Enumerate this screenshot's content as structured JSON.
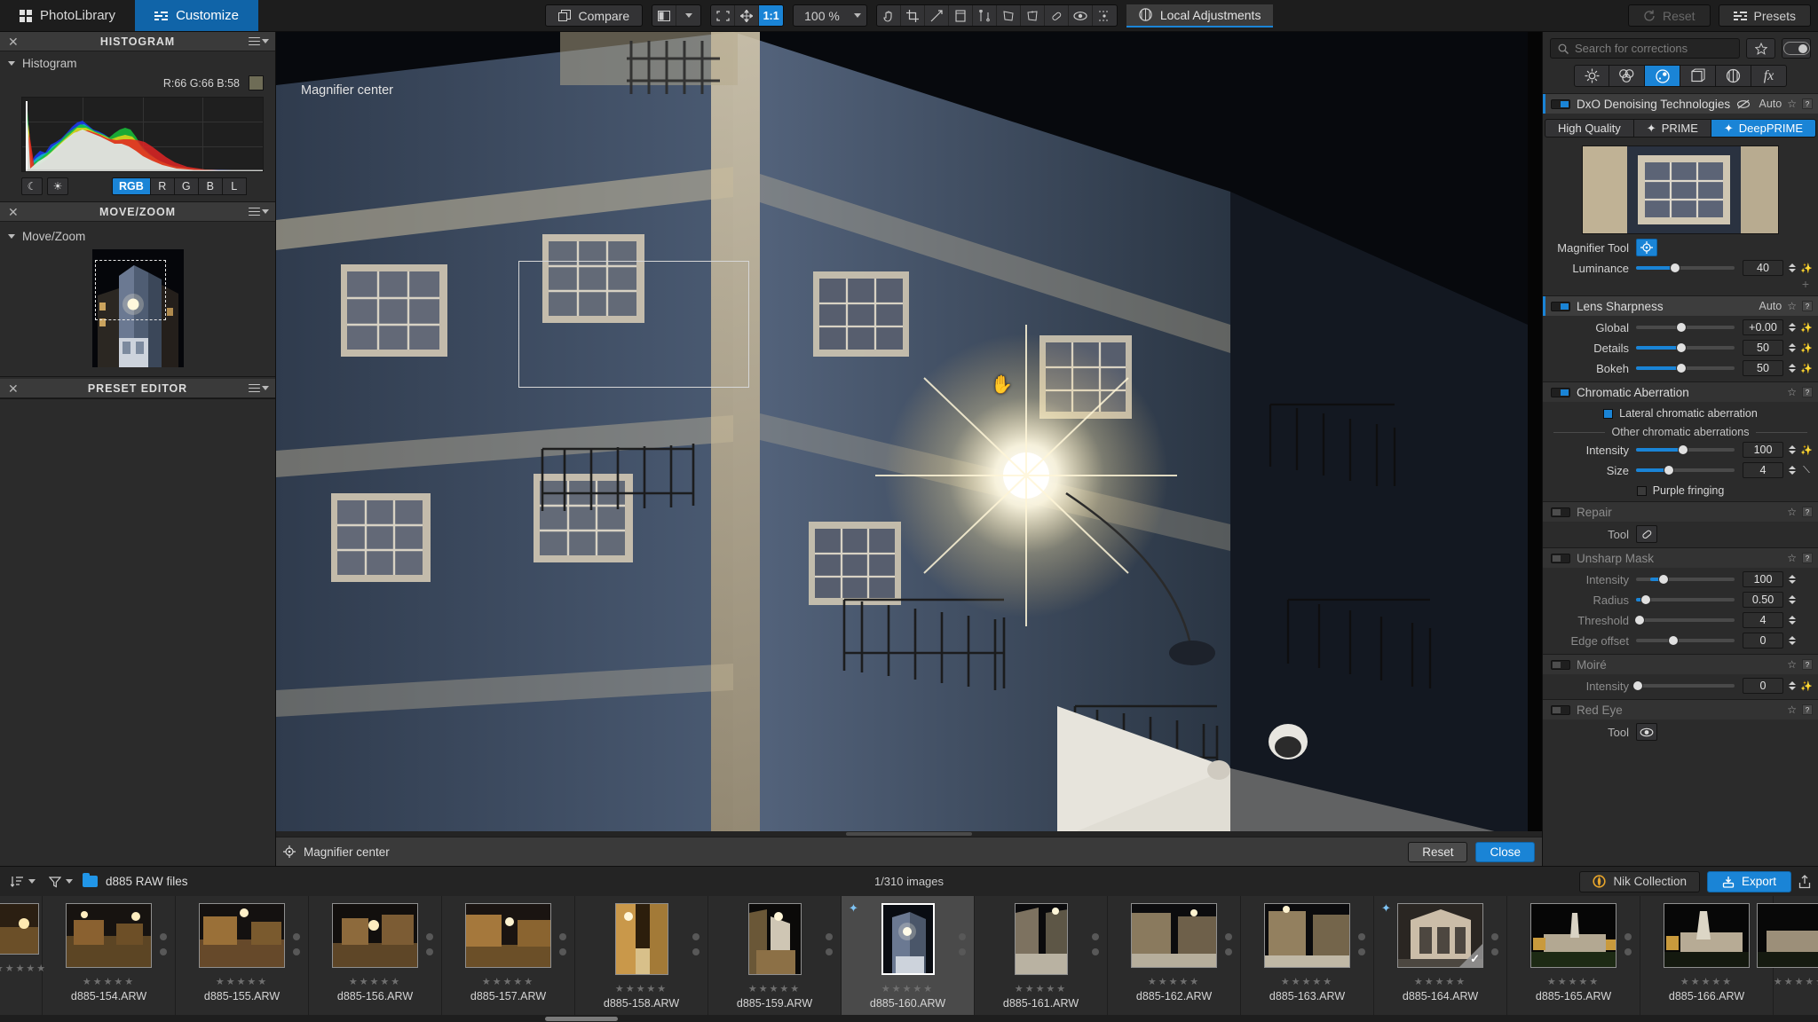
{
  "topbar": {
    "photo_library_tab": "PhotoLibrary",
    "customize_tab": "Customize",
    "compare_label": "Compare",
    "zoom_ratio_label": "1:1",
    "zoom_percent": "100 %",
    "local_adjustments_label": "Local Adjustments",
    "reset_label": "Reset",
    "presets_label": "Presets",
    "icons": {
      "grid": "grid-icon",
      "sliders": "sliders-icon",
      "compare": "compare-copies-icon",
      "split_view": "split-view-icon",
      "fit_screen": "fit-to-screen-icon",
      "move": "move-icon",
      "hand": "hand-tool-icon",
      "crop": "crop-tool-icon",
      "horizon": "horizon-tool-icon",
      "eyedropper": "eyedropper-icon",
      "perspective": "perspective-icon",
      "keystone_2pt": "keystone-2point-icon",
      "keystone_4pt": "keystone-4point-icon",
      "keystone_8pt": "keystone-8point-icon",
      "repair": "repair-patch-icon",
      "eye": "eye-preview-icon",
      "dust": "dust-spots-icon",
      "local_adjust": "local-adjustments-icon",
      "reset": "reset-circular-arrow-icon",
      "presets": "presets-sliders-icon"
    }
  },
  "left_panel": {
    "histogram": {
      "title": "HISTOGRAM",
      "section_label": "Histogram",
      "readout": "R:66 G:66 B:58",
      "swatch_color": "#6e6c56",
      "shadow_btn": "moon-icon",
      "highlight_btn": "sun-icon",
      "channels": [
        "RGB",
        "R",
        "G",
        "B",
        "L"
      ],
      "selected_channel": "RGB"
    },
    "move_zoom": {
      "title": "MOVE/ZOOM",
      "section_label": "Move/Zoom"
    },
    "preset_editor": {
      "title": "PRESET EDITOR"
    }
  },
  "viewer": {
    "overlay_label": "Magnifier center",
    "status_label": "Magnifier center",
    "status_icon": "magnifier-center-icon",
    "reset_label": "Reset",
    "close_label": "Close"
  },
  "right_panel": {
    "search": {
      "placeholder": "Search for corrections",
      "icon": "search-icon",
      "favorite_icon": "star-icon",
      "toggle_icon": "toggle-switch-icon"
    },
    "categories": [
      {
        "name": "light-icon",
        "selected": false
      },
      {
        "name": "color-icon",
        "selected": false
      },
      {
        "name": "detail-icon",
        "selected": true
      },
      {
        "name": "geometry-icon",
        "selected": false
      },
      {
        "name": "local-icon",
        "selected": false
      },
      {
        "name": "effects-fx-icon",
        "selected": false
      }
    ],
    "tools": [
      {
        "id": "denoising",
        "title": "DxO Denoising Technologies",
        "enabled": true,
        "active": true,
        "auto_label": "Auto",
        "extra_icon": "crossed-eye-icon",
        "modes": [
          {
            "label": "High Quality",
            "selected": false,
            "icon": ""
          },
          {
            "label": "PRIME",
            "selected": false,
            "icon": "sparkle-icon"
          },
          {
            "label": "DeepPRIME",
            "selected": true,
            "icon": "sparkle-icon"
          }
        ],
        "magnifier_tool_label": "Magnifier Tool",
        "magnifier_tool_icon": "magnifier-crosshair-icon",
        "sliders": [
          {
            "label": "Luminance",
            "value": "40",
            "fill_pct": 40,
            "knob_pct": 40,
            "enabled": true,
            "has_wand": true
          }
        ]
      },
      {
        "id": "lens_sharpness",
        "title": "Lens Sharpness",
        "enabled": true,
        "active": true,
        "auto_label": "Auto",
        "sliders": [
          {
            "label": "Global",
            "value": "+0.00",
            "fill_pct": 0,
            "knob_pct": 46,
            "enabled": true,
            "has_wand": true
          },
          {
            "label": "Details",
            "value": "50",
            "fill_pct": 46,
            "knob_pct": 46,
            "enabled": true,
            "has_wand": true
          },
          {
            "label": "Bokeh",
            "value": "50",
            "fill_pct": 46,
            "knob_pct": 46,
            "enabled": true,
            "has_wand": false
          }
        ]
      },
      {
        "id": "chromatic_aberration",
        "title": "Chromatic Aberration",
        "enabled": true,
        "active": false,
        "checkbox_lateral": {
          "label": "Lateral chromatic aberration",
          "checked": true
        },
        "divider_label": "Other chromatic aberrations",
        "sliders": [
          {
            "label": "Intensity",
            "value": "100",
            "fill_pct": 48,
            "knob_pct": 48,
            "enabled": true,
            "has_wand": true
          },
          {
            "label": "Size",
            "value": "4",
            "fill_pct": 33,
            "knob_pct": 33,
            "enabled": true,
            "has_wand": true
          }
        ],
        "checkbox_purple": {
          "label": "Purple fringing",
          "checked": false
        }
      },
      {
        "id": "repair",
        "title": "Repair",
        "enabled": false,
        "active": false,
        "tool_label": "Tool",
        "tool_icon": "repair-patch-icon"
      },
      {
        "id": "unsharp_mask",
        "title": "Unsharp Mask",
        "enabled": false,
        "active": false,
        "sliders": [
          {
            "label": "Intensity",
            "value": "100",
            "fill_pct": 28,
            "knob_pct": 28,
            "enabled": true,
            "has_wand": false
          },
          {
            "label": "Radius",
            "value": "0.50",
            "fill_pct": 10,
            "knob_pct": 10,
            "enabled": true,
            "has_wand": false
          },
          {
            "label": "Threshold",
            "value": "4",
            "fill_pct": 0,
            "knob_pct": 5,
            "enabled": false,
            "has_wand": false
          },
          {
            "label": "Edge offset",
            "value": "0",
            "fill_pct": 0,
            "knob_pct": 38,
            "enabled": false,
            "has_wand": false
          }
        ]
      },
      {
        "id": "moire",
        "title": "Moiré",
        "enabled": false,
        "active": false,
        "sliders": [
          {
            "label": "Intensity",
            "value": "0",
            "fill_pct": 0,
            "knob_pct": 3,
            "enabled": false,
            "has_wand": true
          }
        ]
      },
      {
        "id": "red_eye",
        "title": "Red Eye",
        "enabled": false,
        "active": false,
        "tool_label": "Tool",
        "tool_icon": "eye-icon"
      }
    ]
  },
  "filmstrip_bar": {
    "sort_icon": "sort-icon",
    "filter_icon": "filter-funnel-icon",
    "folder_icon": "folder-icon",
    "folder_name": "d885 RAW files",
    "image_count": "1/310 images",
    "nik_label": "Nik Collection",
    "nik_icon": "nik-collection-icon",
    "export_label": "Export",
    "export_icon": "export-icon",
    "share_icon": "share-upload-icon"
  },
  "filmstrip": {
    "items": [
      {
        "name": "",
        "stars": "★★★★★",
        "selected": false,
        "partial": true,
        "orient": "land",
        "edited": false,
        "checked": false,
        "c1": "#2b1f12",
        "c2": "#6b4f28"
      },
      {
        "name": "d885-154.ARW",
        "stars": "★★★★★",
        "selected": false,
        "partial": false,
        "orient": "land",
        "edited": false,
        "checked": false,
        "c1": "#171310",
        "c2": "#8a6130"
      },
      {
        "name": "d885-155.ARW",
        "stars": "★★★★★",
        "selected": false,
        "partial": false,
        "orient": "land",
        "edited": false,
        "checked": false,
        "c1": "#141110",
        "c2": "#9a7038"
      },
      {
        "name": "d885-156.ARW",
        "stars": "★★★★★",
        "selected": false,
        "partial": false,
        "orient": "land",
        "edited": false,
        "checked": false,
        "c1": "#120f0d",
        "c2": "#8d6a3c"
      },
      {
        "name": "d885-157.ARW",
        "stars": "★★★★★",
        "selected": false,
        "partial": false,
        "orient": "land",
        "edited": false,
        "checked": false,
        "c1": "#1a1411",
        "c2": "#a5783c"
      },
      {
        "name": "d885-158.ARW",
        "stars": "★★★★★",
        "selected": false,
        "partial": false,
        "orient": "port",
        "edited": false,
        "checked": false,
        "c1": "#2c1e0c",
        "c2": "#c9984a"
      },
      {
        "name": "d885-159.ARW",
        "stars": "★★★★★",
        "selected": false,
        "partial": false,
        "orient": "port",
        "edited": false,
        "checked": false,
        "c1": "#0b0a09",
        "c2": "#8c7046"
      },
      {
        "name": "d885-160.ARW",
        "stars": "★★★★★",
        "selected": true,
        "partial": false,
        "orient": "port",
        "edited": true,
        "checked": false,
        "c1": "#090c12",
        "c2": "#5a6b82"
      },
      {
        "name": "d885-161.ARW",
        "stars": "★★★★★",
        "selected": false,
        "partial": false,
        "orient": "port",
        "edited": false,
        "checked": false,
        "c1": "#0a0a0c",
        "c2": "#7d7260"
      },
      {
        "name": "d885-162.ARW",
        "stars": "★★★★★",
        "selected": false,
        "partial": false,
        "orient": "land",
        "edited": false,
        "checked": false,
        "c1": "#0c0c0e",
        "c2": "#8a7a5e"
      },
      {
        "name": "d885-163.ARW",
        "stars": "★★★★★",
        "selected": false,
        "partial": false,
        "orient": "land",
        "edited": false,
        "checked": false,
        "c1": "#0b0b0d",
        "c2": "#93805f"
      },
      {
        "name": "d885-164.ARW",
        "stars": "★★★★★",
        "selected": false,
        "partial": false,
        "orient": "land",
        "edited": true,
        "checked": true,
        "c1": "#2a2622",
        "c2": "#cbbda8"
      },
      {
        "name": "d885-165.ARW",
        "stars": "★★★★★",
        "selected": false,
        "partial": false,
        "orient": "land",
        "edited": false,
        "checked": false,
        "c1": "#060606",
        "c2": "#b3a892"
      },
      {
        "name": "d885-166.ARW",
        "stars": "★★★★★",
        "selected": false,
        "partial": false,
        "orient": "land",
        "edited": false,
        "checked": false,
        "c1": "#070707",
        "c2": "#b7ab95"
      },
      {
        "name": "",
        "stars": "★★★★★",
        "selected": false,
        "partial": true,
        "orient": "land",
        "edited": false,
        "checked": false,
        "c1": "#080808",
        "c2": "#9c8f79"
      }
    ]
  }
}
